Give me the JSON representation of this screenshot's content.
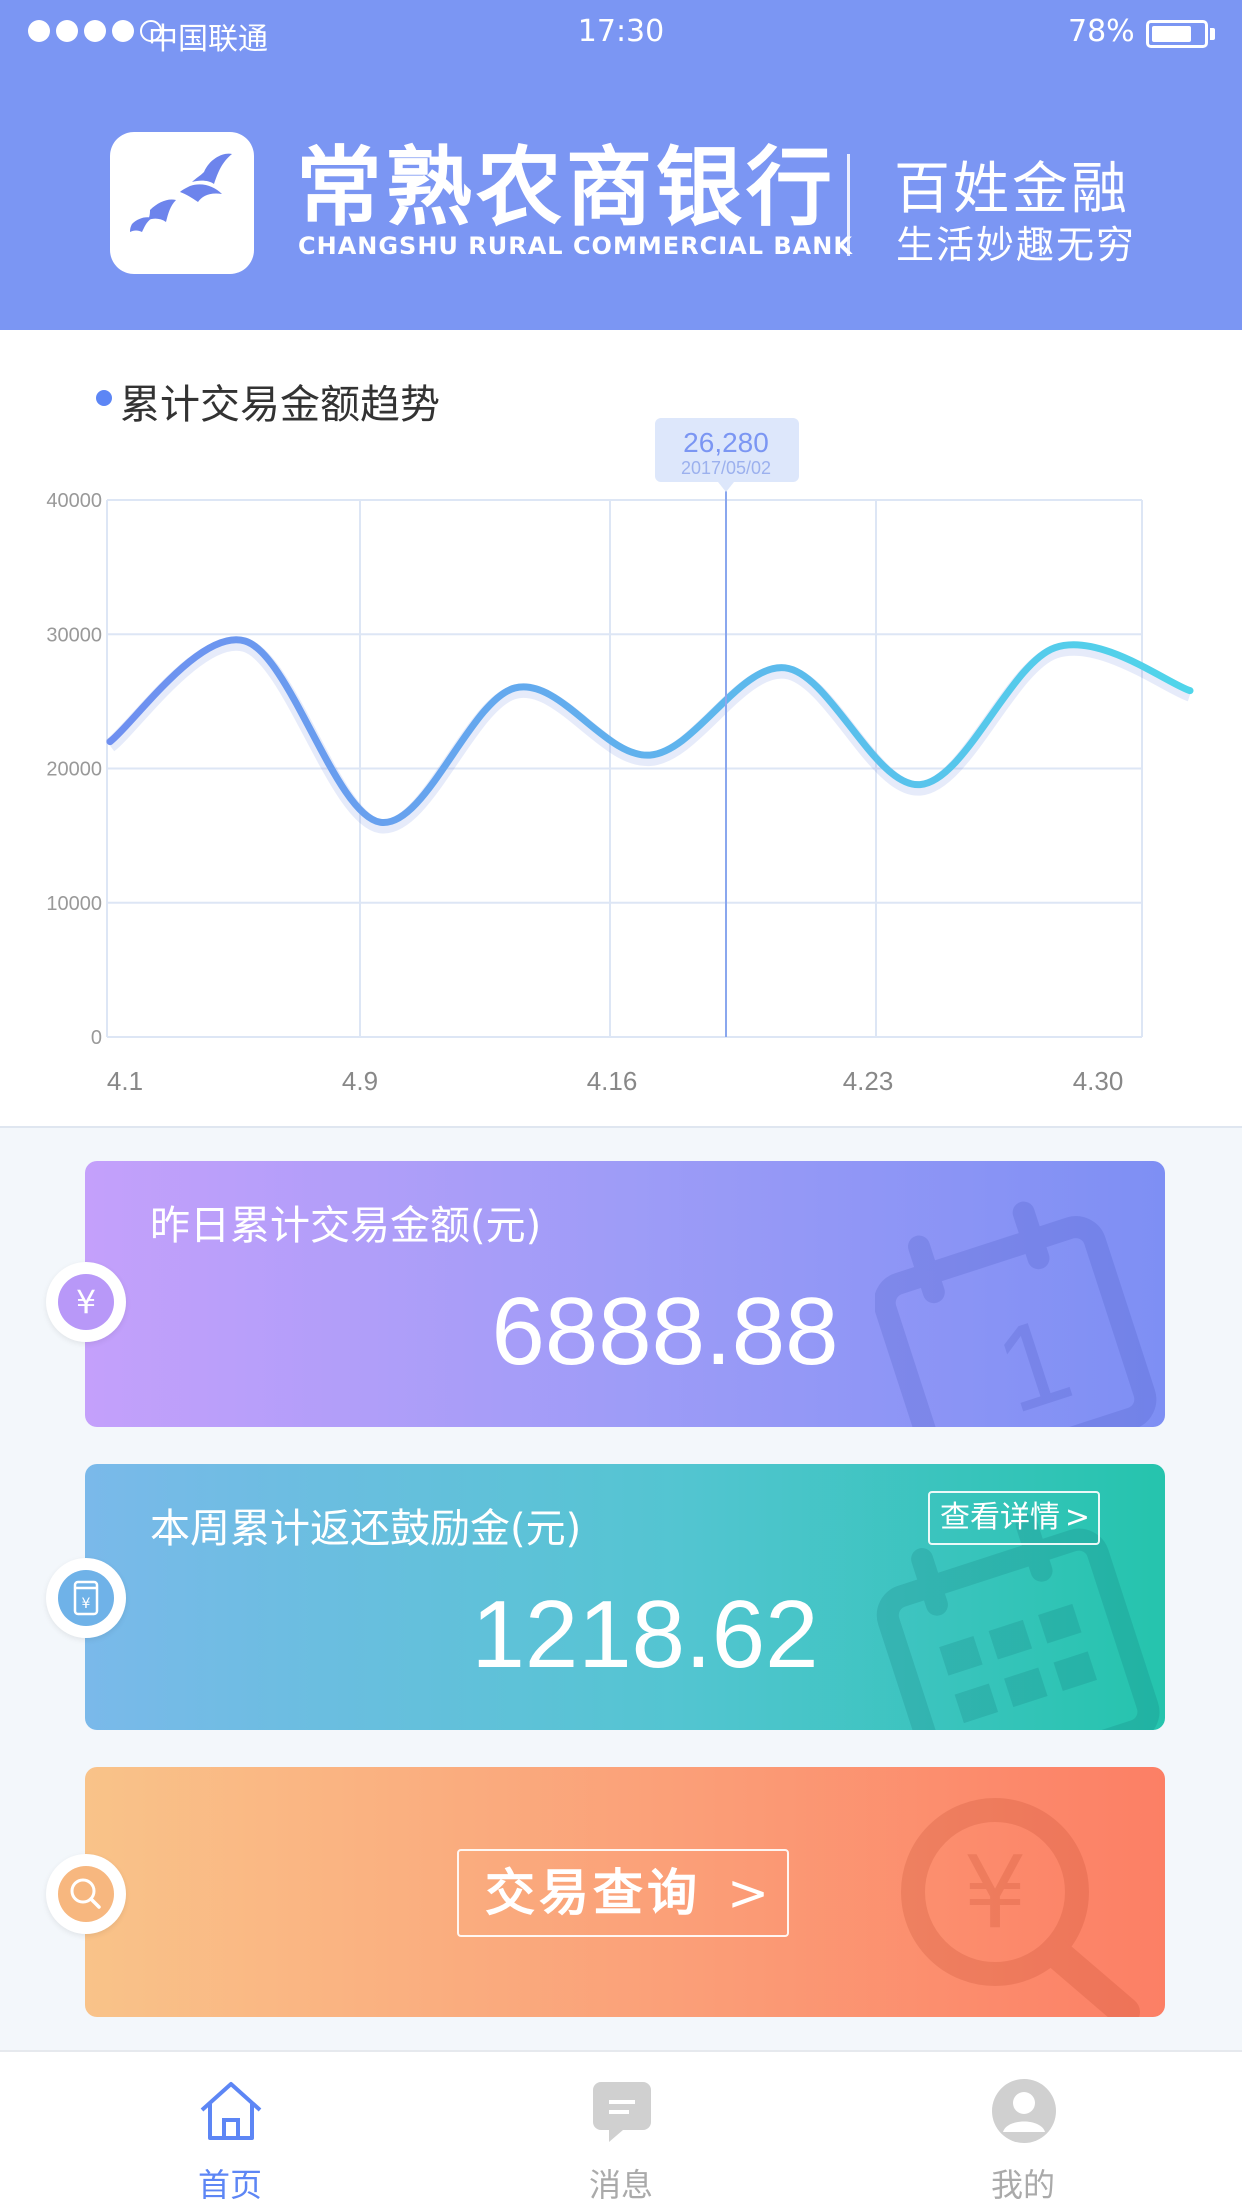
{
  "status_bar": {
    "carrier": "中国联通",
    "time": "17:30",
    "battery": "78%",
    "battery_level": 0.78,
    "signal_bars": 4
  },
  "header": {
    "bank_name_cn": "常熟农商银行",
    "bank_name_en": "CHANGSHU RURAL COMMERCIAL BANK",
    "slogan_title": "百姓金融",
    "slogan_subtitle": "生活妙趣无穷",
    "background_color": "#7b96f3"
  },
  "chart_section": {
    "title": "累计交易金额趋势"
  },
  "chart_data": {
    "type": "line",
    "title": "累计交易金额趋势",
    "xlabel": "",
    "ylabel": "",
    "x_ticks": [
      "4.1",
      "4.9",
      "4.16",
      "4.23",
      "4.30"
    ],
    "y_ticks": [
      "0",
      "10000",
      "20000",
      "30000",
      "40000"
    ],
    "ylim": [
      0,
      40000
    ],
    "grid": true,
    "series": [
      {
        "values": [
          22000,
          29500,
          16000,
          26000,
          21000,
          27500,
          18800,
          29000,
          25800
        ],
        "colors": [
          "#6f8ff0",
          "#50d5ea"
        ]
      }
    ],
    "tooltip": {
      "value": "26,280",
      "date": "2017/05/02"
    }
  },
  "cards": [
    {
      "label": "昨日累计交易金额(元)",
      "value": "6888.88",
      "icon": "yen-icon"
    },
    {
      "label": "本周累计返还鼓励金(元)",
      "value": "1218.62",
      "detail_label": "查看详情",
      "icon": "wallet-icon"
    },
    {
      "query_label": "交易查询",
      "icon": "search-icon"
    }
  ],
  "chevron": ">",
  "tabs": [
    {
      "label": "首页",
      "icon": "home-icon",
      "active": true
    },
    {
      "label": "消息",
      "icon": "message-icon",
      "active": false
    },
    {
      "label": "我的",
      "icon": "user-icon",
      "active": false
    }
  ],
  "colors": {
    "accent": "#5d86f5",
    "tab_inactive": "#aaaaaa"
  }
}
